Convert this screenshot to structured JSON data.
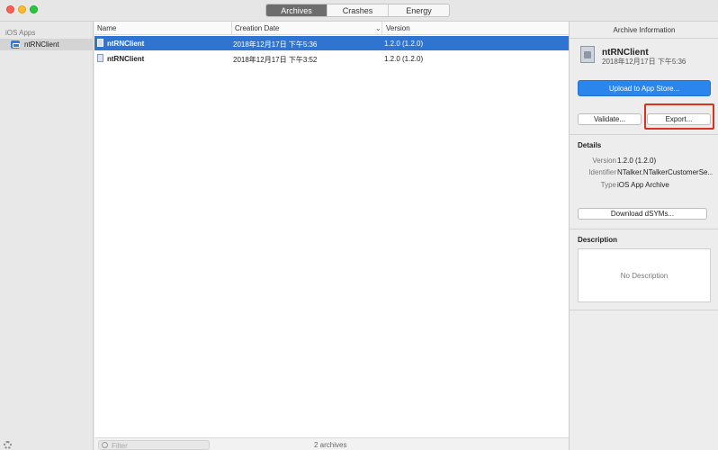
{
  "tabs": [
    {
      "label": "Archives",
      "active": true
    },
    {
      "label": "Crashes",
      "active": false
    },
    {
      "label": "Energy",
      "active": false
    }
  ],
  "sidebar": {
    "header": "iOS Apps",
    "items": [
      {
        "label": "ntRNClient",
        "icon": "app-icon"
      }
    ]
  },
  "table": {
    "columns": [
      "Name",
      "Creation Date",
      "Version"
    ],
    "rows": [
      {
        "name": "ntRNClient",
        "date": "2018年12月17日 下午5:36",
        "version": "1.2.0 (1.2.0)",
        "selected": true
      },
      {
        "name": "ntRNClient",
        "date": "2018年12月17日 下午3:52",
        "version": "1.2.0 (1.2.0)",
        "selected": false
      }
    ]
  },
  "footer": {
    "filter_placeholder": "Filter",
    "count": "2 archives"
  },
  "inspector": {
    "title": "Archive Information",
    "archive_name": "ntRNClient",
    "archive_date": "2018年12月17日 下午5:36",
    "upload_button": "Upload to App Store...",
    "validate_button": "Validate...",
    "export_button": "Export...",
    "details_title": "Details",
    "details": [
      {
        "key": "Version",
        "value": "1.2.0 (1.2.0)"
      },
      {
        "key": "Identifier",
        "value": "NTalker.NTalkerCustomerSe..."
      },
      {
        "key": "Type",
        "value": "iOS App Archive"
      }
    ],
    "dsym_button": "Download dSYMs...",
    "description_title": "Description",
    "description_text": "No Description"
  },
  "colors": {
    "selection": "#2f74d0",
    "primary_button": "#2b86ec",
    "highlight": "#d9331f"
  }
}
